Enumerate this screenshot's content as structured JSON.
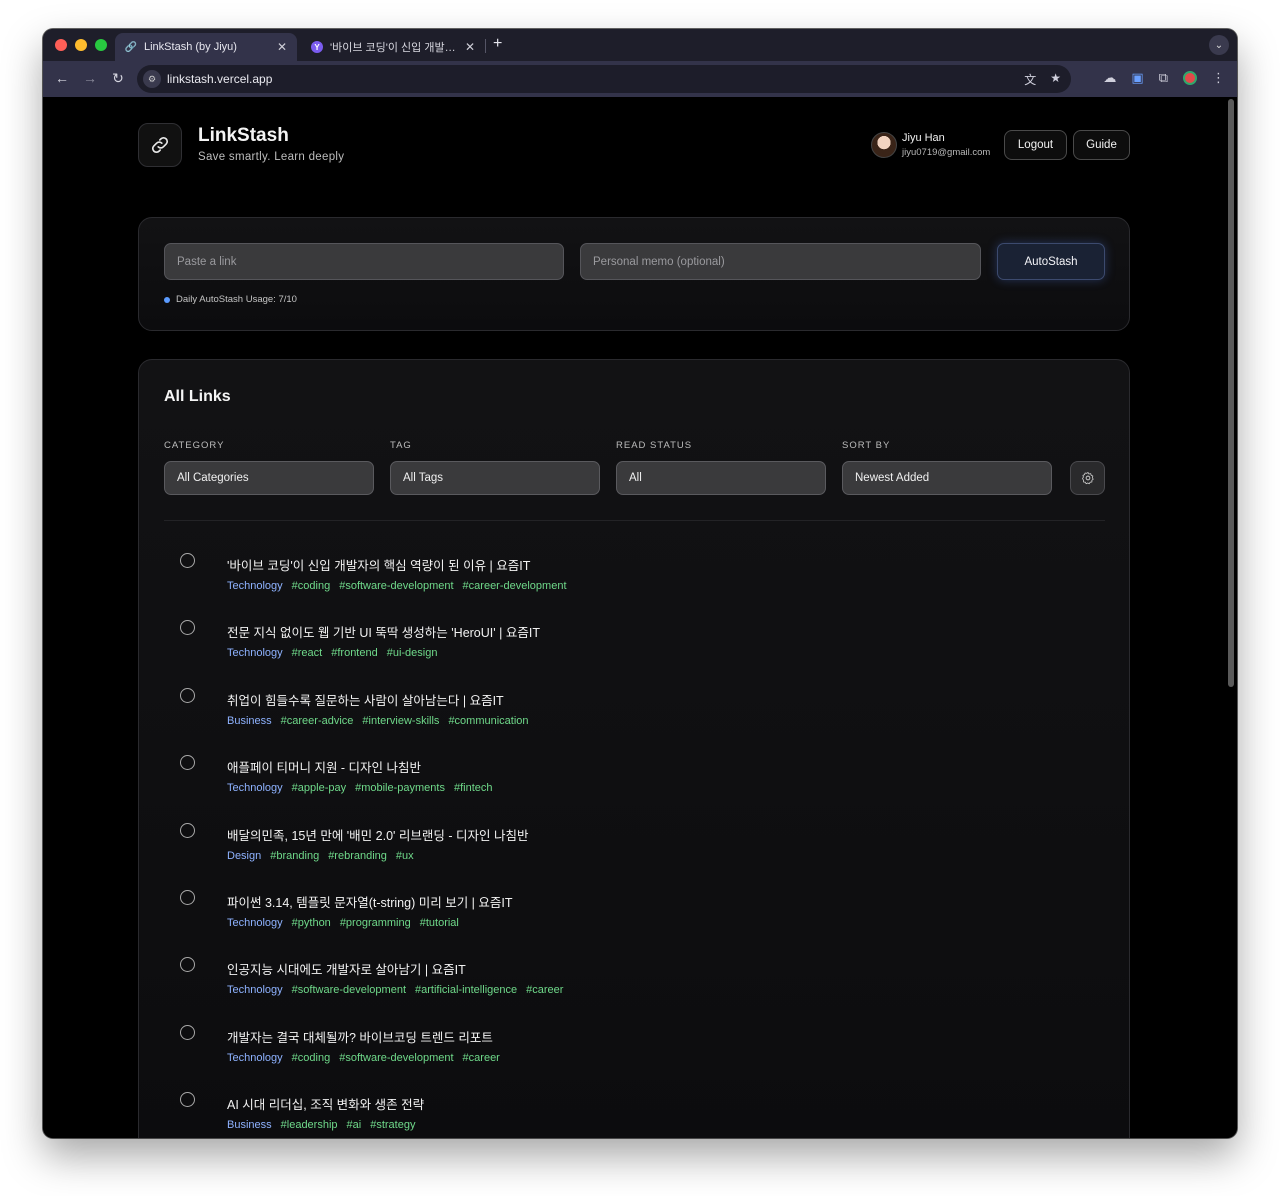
{
  "browser": {
    "tabs": [
      {
        "title": "LinkStash (by Jiyu)",
        "active": true
      },
      {
        "title": "'바이브 코딩'이 신입 개발자의 핵심 역량이 된 이유 | 요즘IT",
        "active": false
      }
    ],
    "url": "linkstash.vercel.app"
  },
  "header": {
    "app_name": "LinkStash",
    "tagline": "Save smartly. Learn deeply",
    "user_name": "Jiyu Han",
    "user_email": "jiyu0719@gmail.com",
    "logout_label": "Logout",
    "guide_label": "Guide"
  },
  "stash_form": {
    "link_placeholder": "Paste a link",
    "memo_placeholder": "Personal memo (optional)",
    "submit_label": "AutoStash",
    "usage_text": "Daily AutoStash Usage: 7/10",
    "usage_accent": "#5b9bff"
  },
  "links": {
    "title": "All Links",
    "filters": {
      "category_label": "CATEGORY",
      "category_value": "All Categories",
      "tag_label": "TAG",
      "tag_value": "All Tags",
      "read_label": "READ STATUS",
      "read_value": "All",
      "sort_label": "SORT BY",
      "sort_value": "Newest Added"
    },
    "colors": {
      "category": "#8eb2ff",
      "tag": "#6fd98a"
    },
    "items": [
      {
        "title": "'바이브 코딩'이 신입 개발자의 핵심 역량이 된 이유 | 요즘IT",
        "category": "Technology",
        "tags": [
          "#coding",
          "#software-development",
          "#career-development"
        ]
      },
      {
        "title": "전문 지식 없이도 웹 기반 UI 뚝딱 생성하는 'HeroUI' | 요즘IT",
        "category": "Technology",
        "tags": [
          "#react",
          "#frontend",
          "#ui-design"
        ]
      },
      {
        "title": "취업이 힘들수록 질문하는 사람이 살아남는다 | 요즘IT",
        "category": "Business",
        "tags": [
          "#career-advice",
          "#interview-skills",
          "#communication"
        ]
      },
      {
        "title": "애플페이 티머니 지원 - 디자인 나침반",
        "category": "Technology",
        "tags": [
          "#apple-pay",
          "#mobile-payments",
          "#fintech"
        ]
      },
      {
        "title": "배달의민족, 15년 만에 '배민 2.0' 리브랜딩 - 디자인 나침반",
        "category": "Design",
        "tags": [
          "#branding",
          "#rebranding",
          "#ux"
        ]
      },
      {
        "title": "파이썬 3.14, 템플릿 문자열(t-string) 미리 보기 | 요즘IT",
        "category": "Technology",
        "tags": [
          "#python",
          "#programming",
          "#tutorial"
        ]
      },
      {
        "title": "인공지능 시대에도 개발자로 살아남기 | 요즘IT",
        "category": "Technology",
        "tags": [
          "#software-development",
          "#artificial-intelligence",
          "#career"
        ]
      },
      {
        "title": "개발자는 결국 대체될까? 바이브코딩 트렌드 리포트",
        "category": "Technology",
        "tags": [
          "#coding",
          "#software-development",
          "#career"
        ]
      },
      {
        "title": "AI 시대 리더십, 조직 변화와 생존 전략",
        "category": "Business",
        "tags": [
          "#leadership",
          "#ai",
          "#strategy"
        ]
      }
    ]
  }
}
